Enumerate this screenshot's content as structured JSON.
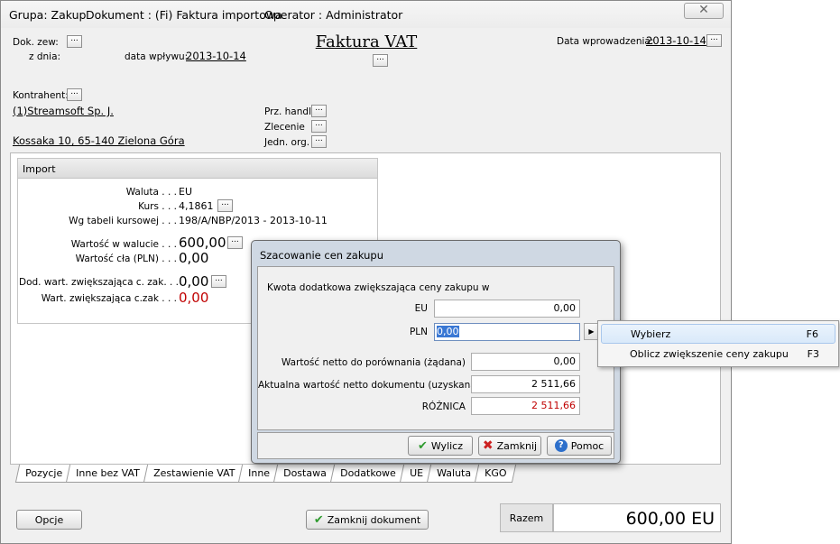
{
  "window": {
    "grupa": "Grupa: Zakup",
    "dokument": "Dokument : (Fi) Faktura importowa",
    "operator": "Operator : Administrator",
    "close_glyph": "✕"
  },
  "header": {
    "title": "Faktura VAT",
    "dok_zew_label": "Dok. zew:",
    "z_dnia_label": "z dnia:",
    "data_wplywu_label": "data wpływu:",
    "data_wplywu": "2013-10-14",
    "data_wprowadzenia_label": "Data wprowadzenia:",
    "data_wprowadzenia": "2013-10-14",
    "kontrahent_label": "Kontrahent:",
    "kontrahent": "(1)Streamsoft Sp. J.",
    "adres": "Kossaka 10, 65-140 Zielona Góra",
    "prz_handl_label": "Prz. handl.",
    "zlecenie_label": "Zlecenie",
    "jedn_org_label": "Jedn. org.",
    "dots": "..."
  },
  "import": {
    "header": "Import",
    "waluta_label": "Waluta . . .",
    "waluta": "EU",
    "kurs_label": "Kurs . . .",
    "kurs": "4,1861",
    "tabela_label": "Wg tabeli kursowej . . .",
    "tabela": "198/A/NBP/2013 - 2013-10-11",
    "wartosc_walucie_label": "Wartość w walucie . . .",
    "wartosc_walucie": "600,00",
    "wartosc_cla_label": "Wartość cła (PLN) . . .",
    "wartosc_cla": "0,00",
    "dod_wart_label": "Dod. wart. zwiększająca c. zak. . .",
    "dod_wart": "0,00",
    "wart_zw_label": "Wart. zwiększająca c.zak . . .",
    "wart_zw": "0,00"
  },
  "tabs": [
    "Pozycje",
    "Inne bez VAT",
    "Zestawienie VAT",
    "Inne",
    "Dostawa",
    "Dodatkowe",
    "UE",
    "Waluta",
    "KGO"
  ],
  "footer": {
    "opcje": "Opcje",
    "zamknij_dokument": "Zamknij dokument",
    "razem_label": "Razem",
    "razem_value": "600,00 EU"
  },
  "dialog": {
    "title": "Szacowanie cen zakupu",
    "intro": "Kwota dodatkowa zwiększająca ceny zakupu w",
    "eu_label": "EU",
    "eu_value": "0,00",
    "pln_label": "PLN",
    "pln_value": "0,00",
    "netto_zadana_label": "Wartość netto do porównania (żądana)",
    "netto_zadana": "0,00",
    "netto_uzyskana_label": "Aktualna wartość netto dokumentu (uzyskana)",
    "netto_uzyskana": "2 511,66",
    "roznica_label": "RÓŻNICA",
    "roznica": "2 511,66",
    "wylicz": "Wylicz",
    "zamknij": "Zamknij",
    "pomoc": "Pomoc"
  },
  "menu": {
    "items": [
      {
        "label": "Wybierz",
        "shortcut": "F6"
      },
      {
        "label": "Oblicz zwiększenie ceny zakupu",
        "shortcut": "F3"
      }
    ]
  },
  "colors": {
    "red_value": "#c00000",
    "selection": "#3a78d4"
  }
}
